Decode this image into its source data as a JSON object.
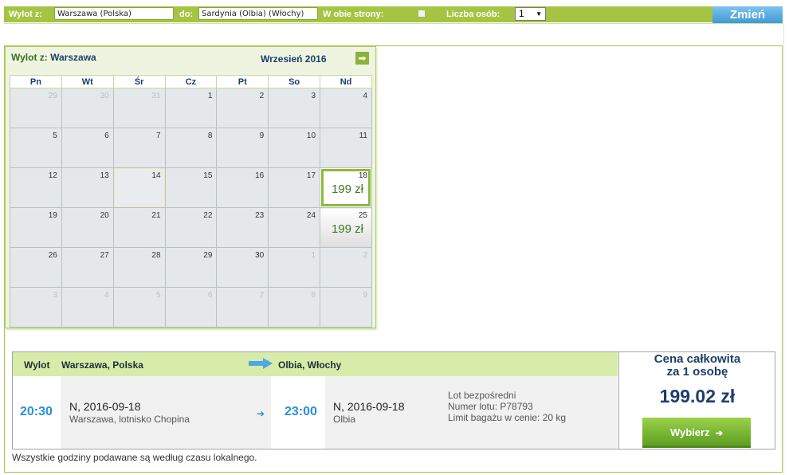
{
  "search": {
    "from_label": "Wylot z:",
    "from_value": "Warszawa (Polska)",
    "to_label": "do:",
    "to_value": "Sardynia (Olbia) (Włochy)",
    "return_label": "W obie strony:",
    "return_checked": false,
    "persons_label": "Liczba osób:",
    "persons_value": "1",
    "arrow_glyph": "▼",
    "change_button": "Zmień"
  },
  "calendar": {
    "from_prefix": "Wylot z:",
    "from_city": "Warszawa",
    "month": "Wrzesień 2016",
    "next_icon": "arrow-right-icon",
    "next_glyph": "➡",
    "weekdays": [
      "Pn",
      "Wt",
      "Śr",
      "Cz",
      "Pt",
      "So",
      "Nd"
    ],
    "weeks": [
      [
        {
          "d": "29",
          "other": true
        },
        {
          "d": "30",
          "other": true
        },
        {
          "d": "31",
          "other": true
        },
        {
          "d": "1"
        },
        {
          "d": "2"
        },
        {
          "d": "3"
        },
        {
          "d": "4"
        }
      ],
      [
        {
          "d": "5"
        },
        {
          "d": "6"
        },
        {
          "d": "7"
        },
        {
          "d": "8"
        },
        {
          "d": "9"
        },
        {
          "d": "10"
        },
        {
          "d": "11"
        }
      ],
      [
        {
          "d": "12"
        },
        {
          "d": "13"
        },
        {
          "d": "14",
          "today": true
        },
        {
          "d": "15"
        },
        {
          "d": "16"
        },
        {
          "d": "17"
        },
        {
          "d": "18",
          "price": "199 zł",
          "selected": true
        }
      ],
      [
        {
          "d": "19"
        },
        {
          "d": "20"
        },
        {
          "d": "21"
        },
        {
          "d": "22"
        },
        {
          "d": "23"
        },
        {
          "d": "24"
        },
        {
          "d": "25",
          "price": "199 zł",
          "available": true
        }
      ],
      [
        {
          "d": "26"
        },
        {
          "d": "27"
        },
        {
          "d": "28"
        },
        {
          "d": "29"
        },
        {
          "d": "30"
        },
        {
          "d": "1",
          "other": true
        },
        {
          "d": "2",
          "other": true
        }
      ],
      [
        {
          "d": "3",
          "other": true
        },
        {
          "d": "4",
          "other": true
        },
        {
          "d": "5",
          "other": true
        },
        {
          "d": "6",
          "other": true
        },
        {
          "d": "7",
          "other": true
        },
        {
          "d": "8",
          "other": true
        },
        {
          "d": "9",
          "other": true
        }
      ]
    ]
  },
  "flight": {
    "header_label": "Wylot",
    "header_from": "Warszawa, Polska",
    "header_to": "Olbia, Włochy",
    "dep_time": "20:30",
    "dep_date": "N, 2016-09-18",
    "dep_place": "Warszawa, lotnisko Chopina",
    "arr_time": "23:00",
    "arr_date": "N, 2016-09-18",
    "arr_place": "Olbia",
    "info_direct": "Lot bezpośredni",
    "info_number": "Numer lotu: P78793",
    "info_baggage": "Limit bagażu w cenie: 20 kg",
    "price_label_1": "Cena całkowita",
    "price_label_2": "za 1 osobę",
    "price_value": "199.02 zł",
    "select_button": "Wybierz",
    "small_arrow": "➔",
    "button_arrow": "➔"
  },
  "note": "Wszystkie godziny podawane są według czasu lokalnego.",
  "colors": {
    "bar_green": "#a5c443",
    "header_green": "#d6eca8",
    "accent_blue": "#2a8fd6",
    "navy": "#1d3e6b",
    "price_green": "#3b7a1e"
  }
}
